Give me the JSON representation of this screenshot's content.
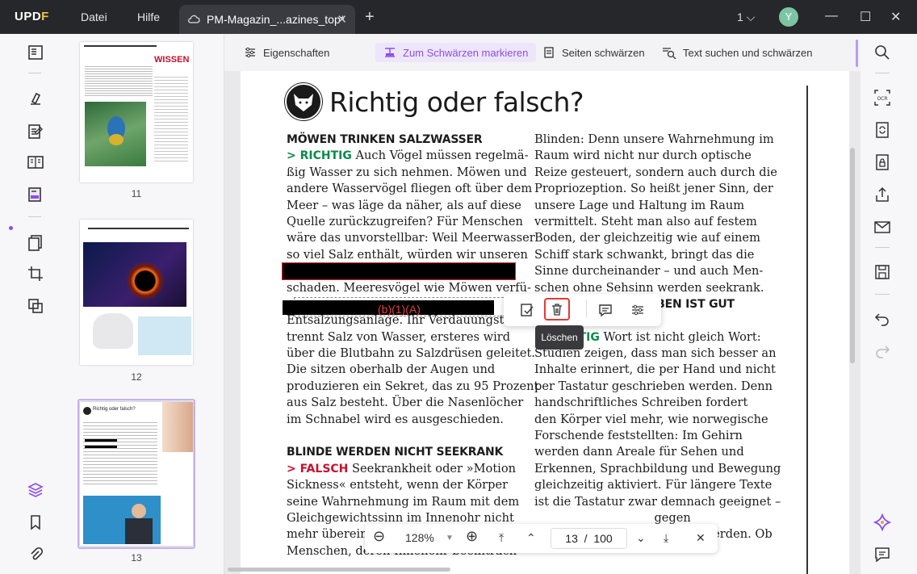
{
  "app": {
    "logo": "UPDF",
    "menus": [
      "Datei",
      "Hilfe"
    ],
    "tab_title": "PM-Magazin_...azines_top*",
    "tab_close": "✕",
    "new_tab": "+",
    "page_count": "1",
    "avatar_letter": "Y"
  },
  "toolbar": {
    "properties": "Eigenschaften",
    "mark_redaction": "Zum Schwärzen markieren",
    "redact_pages": "Seiten schwärzen",
    "search_redact": "Text suchen und schwärzen"
  },
  "thumbnails": [
    {
      "page": "11",
      "heading": "WISSEN"
    },
    {
      "page": "12"
    },
    {
      "page": "13",
      "heading": "Richtig oder falsch?"
    }
  ],
  "document": {
    "title": "Richtig oder falsch?",
    "left_column": [
      {
        "type": "heading",
        "text": "MÖWEN TRINKEN SALZWASSER"
      },
      {
        "type": "tagline",
        "tag": "> RICHTIG",
        "tag_color": "green",
        "text": " Auch Vögel müssen regelmä-"
      },
      {
        "type": "line",
        "text": "ßig Wasser zu sich nehmen. Möwen und"
      },
      {
        "type": "line",
        "text": "andere Wasservögel fliegen oft über dem"
      },
      {
        "type": "line",
        "text": "Meer – was läge da näher, als auf diese"
      },
      {
        "type": "line",
        "text": "Quelle zurückzugreifen? Für Menschen"
      },
      {
        "type": "line",
        "text": "wäre das unvorstellbar: Weil Meerwasser"
      },
      {
        "type": "line",
        "text": "so viel Salz enthält, würden wir unseren"
      },
      {
        "type": "line",
        "text": ""
      },
      {
        "type": "line",
        "text": "schaden. Meeresvögel wie Möwen verfü-"
      },
      {
        "type": "line",
        "text": ""
      },
      {
        "type": "line",
        "text": "Entsalzungsanlage. Ihr Verdauungstrakt"
      },
      {
        "type": "line",
        "text": "trennt Salz von Wasser, ersteres wird"
      },
      {
        "type": "line",
        "text": "über die Blutbahn zu Salzdrüsen geleitet."
      },
      {
        "type": "line",
        "text": "Die sitzen oberhalb der Augen und"
      },
      {
        "type": "line",
        "text": "produzieren ein Sekret, das zu 95 Prozent"
      },
      {
        "type": "line",
        "text": "aus Salz besteht. Über die Nasenlöcher"
      },
      {
        "type": "line",
        "text": "im Schnabel wird es ausgeschieden."
      },
      {
        "type": "line",
        "text": ""
      },
      {
        "type": "heading",
        "text": "BLINDE WERDEN NICHT SEEKRANK"
      },
      {
        "type": "tagline",
        "tag": "> FALSCH",
        "tag_color": "red",
        "text": " Seekrankheit oder »Motion"
      },
      {
        "type": "line",
        "text": "Sickness« entsteht, wenn der Körper"
      },
      {
        "type": "line",
        "text": "seine Wahrnehmung im Raum mit dem"
      },
      {
        "type": "line",
        "text": "Gleichgewichtssinn im Innenohr nicht"
      },
      {
        "type": "line",
        "text": "mehr überein"
      },
      {
        "type": "line",
        "text": "Menschen, deren Innenohr beeinträch-"
      }
    ],
    "right_column": [
      {
        "type": "line",
        "text": "Blinden: Denn unsere Wahrnehmung im"
      },
      {
        "type": "line",
        "text": "Raum wird nicht nur durch optische"
      },
      {
        "type": "line",
        "text": "Reize gesteuert, sondern auch durch die"
      },
      {
        "type": "line",
        "text": "Propriozeption. So heißt jener Sinn, der"
      },
      {
        "type": "line",
        "text": "unsere Lage und Haltung im Raum"
      },
      {
        "type": "line",
        "text": "vermittelt. Steht man also auf festem"
      },
      {
        "type": "line",
        "text": "Boden, der gleichzeitig wie auf einem"
      },
      {
        "type": "line",
        "text": "Schiff stark schwankt, bringt das die"
      },
      {
        "type": "line",
        "text": "Sinne durcheinander – und auch Men-"
      },
      {
        "type": "line",
        "text": "schen ohne Sehsinn werden seekrank."
      },
      {
        "type": "heading",
        "text": "                           REIBEN IST GUT"
      },
      {
        "type": "heading",
        "text": "                     GEHIRN"
      },
      {
        "type": "tagline",
        "tag": "> RICHTIG",
        "tag_color": "green",
        "text": " Wort ist nicht gleich Wort:"
      },
      {
        "type": "line",
        "text": "Studien zeigen, dass man sich besser an"
      },
      {
        "type": "line",
        "text": "Inhalte erinnert, die per Hand und nicht"
      },
      {
        "type": "line",
        "text": "per Tastatur geschrieben werden. Denn"
      },
      {
        "type": "line",
        "text": "handschriftliches Schreiben fordert"
      },
      {
        "type": "line",
        "text": "den Körper viel mehr, wie norwegische"
      },
      {
        "type": "line",
        "text": "Forschende feststellten: Im Gehirn"
      },
      {
        "type": "line",
        "text": "werden dann Areale für Sehen und"
      },
      {
        "type": "line",
        "text": "Erkennen, Sprachbildung und Bewegung"
      },
      {
        "type": "line",
        "text": "gleichzeitig aktiviert. Für längere Texte"
      },
      {
        "type": "line",
        "text": "ist die Tastatur zwar demnach geeignet –"
      },
      {
        "type": "line",
        "text": "                                gegen"
      },
      {
        "type": "line",
        "text": "unbedingt der Stift gezückt werden. Ob"
      }
    ],
    "redaction_label": "(b)(1)(A)"
  },
  "popup": {
    "tooltip": "Löschen"
  },
  "nav": {
    "zoom": "128%",
    "current_page": "13",
    "separator": "/",
    "total_pages": "100"
  }
}
